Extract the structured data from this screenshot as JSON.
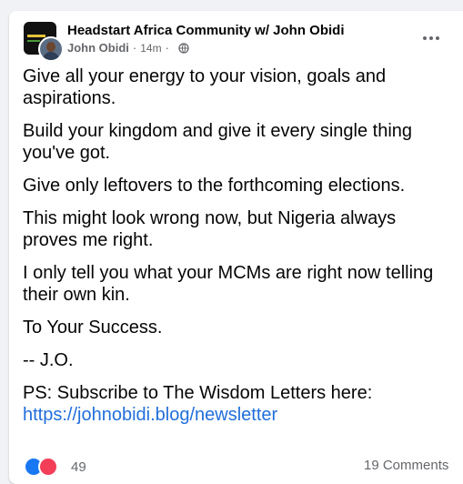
{
  "post": {
    "group_name": "Headstart Africa Community w/ John Obidi",
    "author": "John Obidi",
    "time": "14m",
    "separator": "·",
    "privacy_icon": "globe-icon",
    "more_icon": "more-options-icon",
    "paragraphs": [
      "Give all your energy to your vision, goals and aspirations.",
      "Build your kingdom and give it every single thing you've got.",
      "Give only leftovers to the forthcoming elections.",
      "This might look wrong now, but Nigeria always proves me right.",
      "I only tell you what your MCMs are right now telling their own kin.",
      "To Your Success.",
      "-- J.O.",
      "PS: Subscribe to The Wisdom Letters here:"
    ],
    "link": "https://johnobidi.blog/newsletter"
  },
  "footer": {
    "reaction_icons": [
      "like-icon",
      "love-icon"
    ],
    "reaction_count": "49",
    "comments_label": "19 Comments"
  },
  "colors": {
    "background": "#f0f2f5",
    "card": "#ffffff",
    "link": "#216fdb",
    "text": "#050505",
    "secondary": "#65676b"
  }
}
